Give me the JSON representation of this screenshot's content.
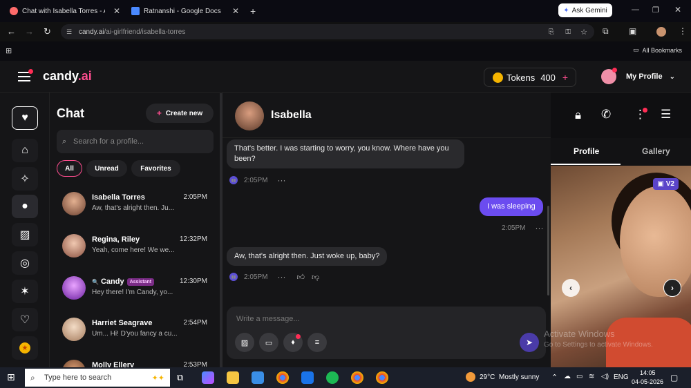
{
  "browser": {
    "tabs": [
      {
        "title": "Chat with Isabella Torres - AI G",
        "favicon_color": "#ff6b6b"
      },
      {
        "title": "Ratnanshi - Google Docs",
        "favicon_color": "#4a89ff"
      }
    ],
    "new_tab": "+",
    "ask_gemini": "Ask Gemini",
    "url_domain": "candy.ai",
    "url_path": "/ai-girlfriend/isabella-torres",
    "all_bookmarks": "All Bookmarks"
  },
  "app": {
    "logo_main": "candy",
    "logo_suffix": ".ai",
    "tokens_label": "Tokens",
    "tokens_value": "400",
    "tokens_plus": "+",
    "profile_label": "My Profile"
  },
  "chatlist": {
    "title": "Chat",
    "create_new": "Create new",
    "search_placeholder": "Search for a profile...",
    "filters": [
      "All",
      "Unread",
      "Favorites"
    ],
    "items": [
      {
        "name": "Isabella Torres",
        "time": "2:05PM",
        "preview": "Aw, that's alright then. Ju...",
        "color": "#b87a5a"
      },
      {
        "name": "Regina, Riley",
        "time": "12:32PM",
        "preview": "Yeah, come here! We we...",
        "color": "#c98b73"
      },
      {
        "name": "Candy",
        "badge": "Assistant",
        "time": "12:30PM",
        "preview": "Hey there! I'm Candy, yo...",
        "color": "#b94adf"
      },
      {
        "name": "Harriet Seagrave",
        "time": "2:54PM",
        "preview": "Um... Hi! D'you fancy a cu...",
        "color": "#d9b59a"
      },
      {
        "name": "Molly Ellery",
        "time": "2:53PM",
        "preview": "",
        "color": "#a06a4b"
      }
    ]
  },
  "chat": {
    "name": "Isabella",
    "messages": [
      {
        "role": "bot",
        "text_line1": "That's better. I was starting to worry, you know. Where have you",
        "text_line2": "been?",
        "time": "2:05PM"
      },
      {
        "role": "user",
        "text": "I was sleeping",
        "time": "2:05PM"
      },
      {
        "role": "bot",
        "text": "Aw, that's alright then. Just woke up, baby?",
        "time": "2:05PM"
      }
    ],
    "composer_placeholder": "Write a message..."
  },
  "panel": {
    "tabs": [
      "Profile",
      "Gallery"
    ],
    "badge": "V2"
  },
  "watermark": {
    "line1": "Activate Windows",
    "line2": "Go to Settings to activate Windows."
  },
  "taskbar": {
    "search": "Type here to search",
    "weather_temp": "29°C",
    "weather_desc": "Mostly sunny",
    "lang": "ENG",
    "time": "14:05",
    "date": "04-05-2026"
  },
  "colors": {
    "accent": "#ff4d8f",
    "user_bubble": "#6b4cf0"
  }
}
